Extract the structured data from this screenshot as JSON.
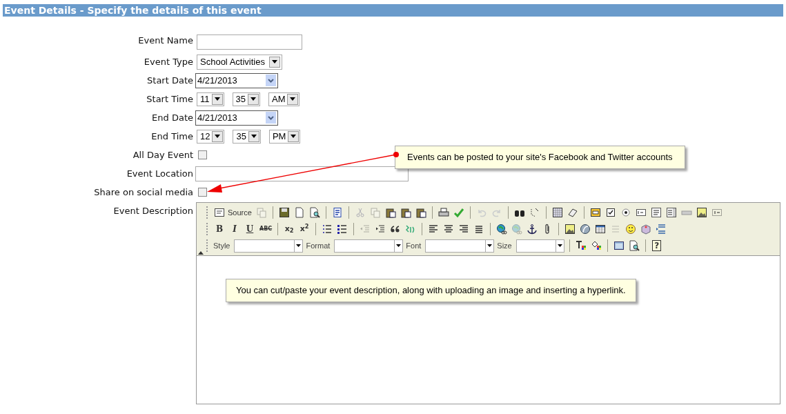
{
  "header": {
    "title": "Event Details - Specify the details of this event"
  },
  "fields": [
    {
      "kind": "text",
      "label": "Event Name"
    },
    {
      "kind": "select",
      "label": "Event Type",
      "value": "School Activities"
    },
    {
      "kind": "date",
      "label": "Start Date",
      "value": "4/21/2013"
    },
    {
      "kind": "time",
      "label": "Start Time",
      "parts": [
        "11",
        "35",
        "AM"
      ]
    },
    {
      "kind": "date",
      "label": "End Date",
      "value": "4/21/2013"
    },
    {
      "kind": "time",
      "label": "End Time",
      "parts": [
        "12",
        "35",
        "PM"
      ]
    },
    {
      "kind": "checkbox",
      "label": "All Day Event",
      "checked": false
    },
    {
      "kind": "wide_text",
      "label": "Event Location"
    },
    {
      "kind": "checkbox",
      "label": "Share on social media",
      "checked": false
    },
    {
      "kind": "editor",
      "label": "Event Description"
    }
  ],
  "toolbar": [
    [
      [
        {
          "kind": "text_icon",
          "label": "Source",
          "disabled": false
        },
        {
          "kind": "icon",
          "disabled": true
        }
      ],
      [
        {
          "kind": "icon",
          "disabled": false
        },
        {
          "kind": "icon",
          "disabled": false
        },
        {
          "kind": "icon",
          "disabled": false
        }
      ],
      [
        {
          "kind": "icon",
          "disabled": false
        }
      ],
      [
        {
          "kind": "icon",
          "disabled": true
        },
        {
          "kind": "icon",
          "disabled": true
        },
        {
          "kind": "icon",
          "disabled": false
        },
        {
          "kind": "icon",
          "disabled": false
        },
        {
          "kind": "icon",
          "disabled": false
        }
      ],
      [
        {
          "kind": "icon",
          "disabled": false
        },
        {
          "kind": "icon",
          "disabled": false
        }
      ],
      [
        {
          "kind": "icon",
          "disabled": true
        },
        {
          "kind": "icon",
          "disabled": true
        }
      ],
      [
        {
          "kind": "icon",
          "disabled": false
        },
        {
          "kind": "icon",
          "disabled": false
        }
      ],
      [
        {
          "kind": "icon",
          "disabled": false
        },
        {
          "kind": "icon",
          "disabled": false
        }
      ],
      [
        {
          "kind": "icon",
          "disabled": false
        },
        {
          "kind": "icon",
          "disabled": false
        },
        {
          "kind": "icon",
          "disabled": false
        },
        {
          "kind": "icon",
          "disabled": false
        },
        {
          "kind": "icon",
          "disabled": false
        },
        {
          "kind": "icon",
          "disabled": false
        },
        {
          "kind": "icon",
          "disabled": false
        },
        {
          "kind": "icon",
          "disabled": false
        },
        {
          "kind": "icon",
          "disabled": false
        }
      ]
    ],
    [
      [
        {
          "kind": "glyph",
          "label": "B"
        },
        {
          "kind": "glyph",
          "label": "I"
        },
        {
          "kind": "glyph",
          "label": "U"
        },
        {
          "kind": "glyph",
          "label": "ABC"
        }
      ],
      [
        {
          "kind": "glyph",
          "label": "x$_{2}$"
        },
        {
          "kind": "glyph",
          "label": "x$^{2}$"
        }
      ],
      [
        {
          "kind": "icon",
          "disabled": false
        },
        {
          "kind": "icon",
          "disabled": false
        }
      ],
      [
        {
          "kind": "icon",
          "disabled": true
        },
        {
          "kind": "icon",
          "disabled": false
        },
        {
          "kind": "icon",
          "disabled": false
        },
        {
          "kind": "icon",
          "disabled": false
        }
      ],
      [
        {
          "kind": "icon",
          "disabled": false
        },
        {
          "kind": "icon",
          "disabled": false
        },
        {
          "kind": "icon",
          "disabled": false
        },
        {
          "kind": "icon",
          "disabled": false
        }
      ],
      [
        {
          "kind": "icon",
          "disabled": false
        },
        {
          "kind": "icon",
          "disabled": true
        },
        {
          "kind": "icon",
          "disabled": false
        },
        {
          "kind": "icon",
          "disabled": false
        }
      ],
      [
        {
          "kind": "icon",
          "disabled": false
        },
        {
          "kind": "icon",
          "disabled": false
        },
        {
          "kind": "icon",
          "disabled": false
        },
        {
          "kind": "icon",
          "disabled": true
        },
        {
          "kind": "icon",
          "disabled": false
        },
        {
          "kind": "icon",
          "disabled": false
        },
        {
          "kind": "icon",
          "disabled": false
        }
      ]
    ],
    [
      [
        {
          "kind": "combo",
          "label": "Style"
        },
        {
          "kind": "combo",
          "label": "Format"
        },
        {
          "kind": "combo",
          "label": "Font"
        },
        {
          "kind": "combo",
          "label": "Size"
        }
      ],
      [
        {
          "kind": "icon",
          "disabled": false
        },
        {
          "kind": "icon",
          "disabled": false
        }
      ],
      [
        {
          "kind": "icon",
          "disabled": false
        },
        {
          "kind": "icon",
          "disabled": false
        }
      ],
      [
        {
          "kind": "glyph",
          "label": "?"
        }
      ]
    ]
  ],
  "callouts": [
    {
      "text": "Events can be posted to your site's Facebook and Twitter accounts"
    },
    {
      "text": "You can cut/paste your event description, along with uploading an image and inserting a hyperlink."
    }
  ]
}
